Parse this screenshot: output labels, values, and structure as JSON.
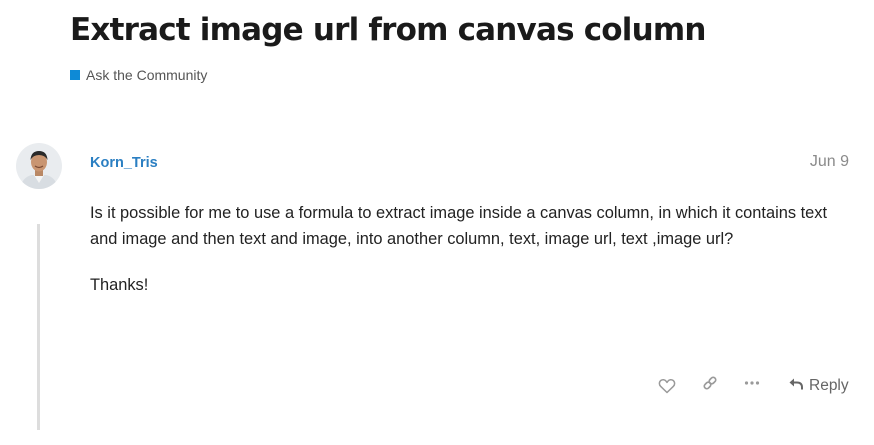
{
  "topic": {
    "title": "Extract image url from canvas column",
    "category": "Ask the Community",
    "category_color": "#0E8AD6"
  },
  "post": {
    "username": "Korn_Tris",
    "date": "Jun 9",
    "paragraphs": [
      "Is it possible for me to use a formula to extract image inside a canvas column, in which it contains text and image and then text and image, into another column, text, image url, text ,image url?",
      "Thanks!"
    ]
  },
  "actions": {
    "like_icon": "heart-icon",
    "link_icon": "link-icon",
    "more_icon": "ellipsis-icon",
    "reply_icon": "reply-arrow-icon",
    "reply_label": "Reply"
  },
  "colors": {
    "username": "#2b7fc2",
    "icon": "#9a9a9a"
  }
}
